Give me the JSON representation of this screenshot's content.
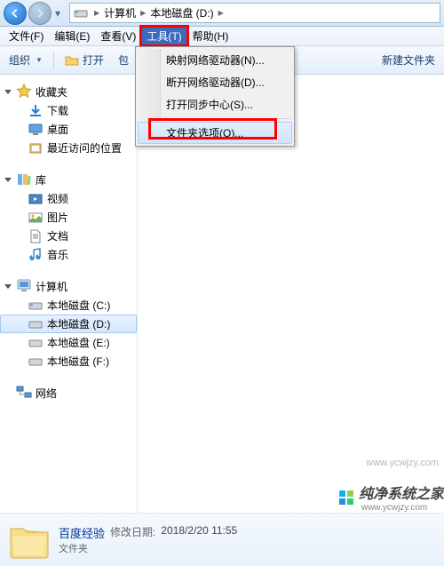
{
  "breadcrumb": {
    "root": "计算机",
    "location": "本地磁盘 (D:)"
  },
  "menubar": {
    "file": "文件(F)",
    "edit": "编辑(E)",
    "view": "查看(V)",
    "tools": "工具(T)",
    "help": "帮助(H)"
  },
  "dropdown": {
    "map_drive": "映射网络驱动器(N)...",
    "disconnect_drive": "断开网络驱动器(D)...",
    "open_sync": "打开同步中心(S)...",
    "folder_options": "文件夹选项(O)..."
  },
  "toolbar": {
    "organize": "组织",
    "open": "打开",
    "include": "包",
    "new_folder": "新建文件夹"
  },
  "sidebar": {
    "favorites": {
      "title": "收藏夹",
      "downloads": "下载",
      "desktop": "桌面",
      "recent": "最近访问的位置"
    },
    "libraries": {
      "title": "库",
      "videos": "视频",
      "pictures": "图片",
      "documents": "文档",
      "music": "音乐"
    },
    "computer": {
      "title": "计算机",
      "c": "本地磁盘 (C:)",
      "d": "本地磁盘 (D:)",
      "e": "本地磁盘 (E:)",
      "f": "本地磁盘 (F:)"
    },
    "network": {
      "title": "网络"
    }
  },
  "details": {
    "name": "百度经验",
    "type": "文件夹",
    "date_label": "修改日期:",
    "date": "2018/2/20 11:55"
  },
  "watermark1": "www.ycwjzy.com",
  "watermark2": {
    "text": "纯净系统之家",
    "sub": "www.ycwjzy.com"
  }
}
